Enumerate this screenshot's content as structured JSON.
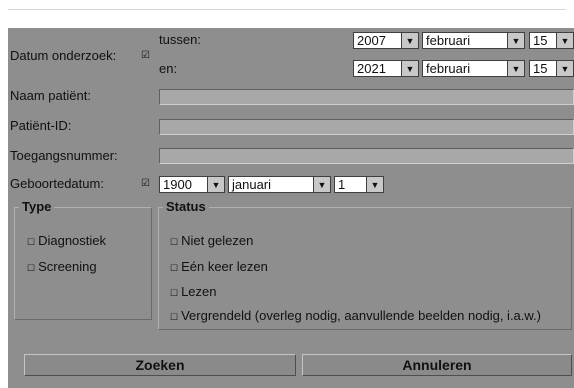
{
  "exam_date": {
    "label": "Datum onderzoek:",
    "check": "☑",
    "from_label": "tussen:",
    "to_label": "en:",
    "from": {
      "year": "2007",
      "month": "februari",
      "day": "15"
    },
    "to": {
      "year": "2021",
      "month": "februari",
      "day": "15"
    }
  },
  "patient_name": {
    "label": "Naam patiënt:",
    "value": ""
  },
  "patient_id": {
    "label": "Patiënt-ID:",
    "value": ""
  },
  "accession": {
    "label": "Toegangsnummer:",
    "value": ""
  },
  "birth_date": {
    "label": "Geboortedatum:",
    "check": "☑",
    "year": "1900",
    "month": "januari",
    "day": "1"
  },
  "type_group": {
    "legend": "Type",
    "options": [
      {
        "label": "Diagnostiek",
        "checked": false
      },
      {
        "label": "Screening",
        "checked": false
      }
    ]
  },
  "status_group": {
    "legend": "Status",
    "options": [
      {
        "label": "Niet gelezen",
        "checked": false
      },
      {
        "label": "Eén keer lezen",
        "checked": false
      },
      {
        "label": "Lezen",
        "checked": false
      },
      {
        "label": "Vergrendeld (overleg nodig, aanvullende beelden nodig, i.a.w.)",
        "checked": false
      }
    ]
  },
  "buttons": {
    "search": "Zoeken",
    "cancel": "Annuleren"
  },
  "icons": {
    "unchecked": "☐",
    "dropdown": "▼"
  },
  "colors": {
    "panel": "#8e8e8e",
    "field": "#a8a8a8",
    "dropdown_bg": "#ffffff"
  }
}
